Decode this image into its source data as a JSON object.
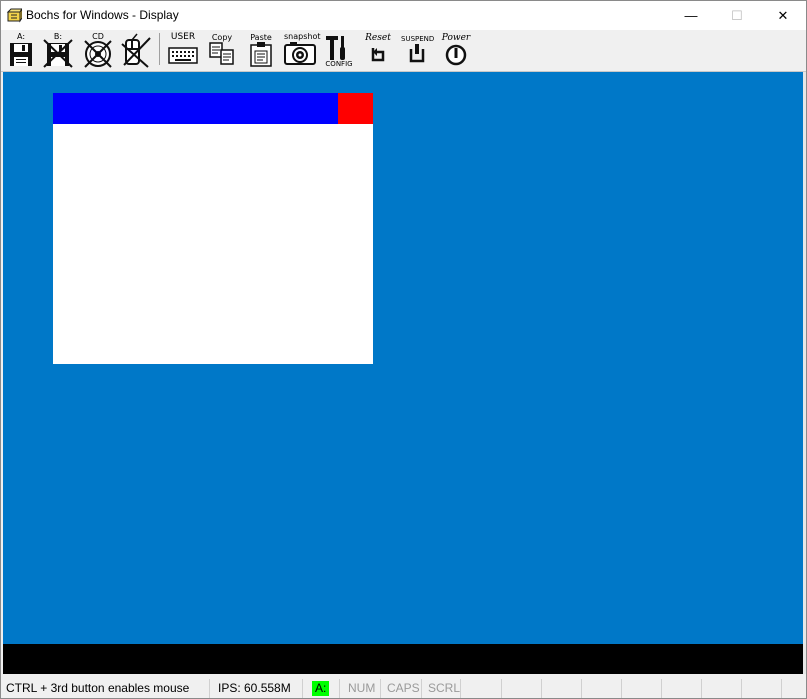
{
  "window": {
    "title": "Bochs for Windows - Display",
    "controls": {
      "minimize": "—",
      "maximize": "☐",
      "close": "✕"
    }
  },
  "toolbar": {
    "floppy_a": {
      "label": "A:",
      "icon": "floppy-icon"
    },
    "floppy_b": {
      "label": "B:",
      "icon": "floppy-icon"
    },
    "cdrom": {
      "label": "CD",
      "icon": "cdrom-icon"
    },
    "mouse": {
      "label": "",
      "icon": "mouse-icon"
    },
    "user": {
      "label": "USER",
      "icon": "keyboard-icon"
    },
    "copy": {
      "label": "Copy",
      "icon": "copy-icon"
    },
    "paste": {
      "label": "Paste",
      "icon": "paste-icon"
    },
    "snapshot": {
      "label": "snapshot",
      "icon": "camera-icon"
    },
    "config": {
      "label": "CONFIG",
      "icon": "config-icon"
    },
    "reset": {
      "label": "Reset",
      "icon": "reset-icon"
    },
    "suspend": {
      "label": "SUSPEND",
      "icon": "suspend-icon"
    },
    "power": {
      "label": "Power",
      "icon": "power-icon"
    }
  },
  "display": {
    "background_color": "#0078c8",
    "guest_window": {
      "title_color": "#0000ff",
      "close_color": "#ff0000",
      "body_color": "#ffffff"
    }
  },
  "statusbar": {
    "hint": "CTRL + 3rd button enables mouse",
    "ips": "IPS: 60.558M",
    "drive": "A:",
    "num": "NUM",
    "caps": "CAPS",
    "scrl": "SCRL",
    "drive_color": "#00ff00"
  }
}
